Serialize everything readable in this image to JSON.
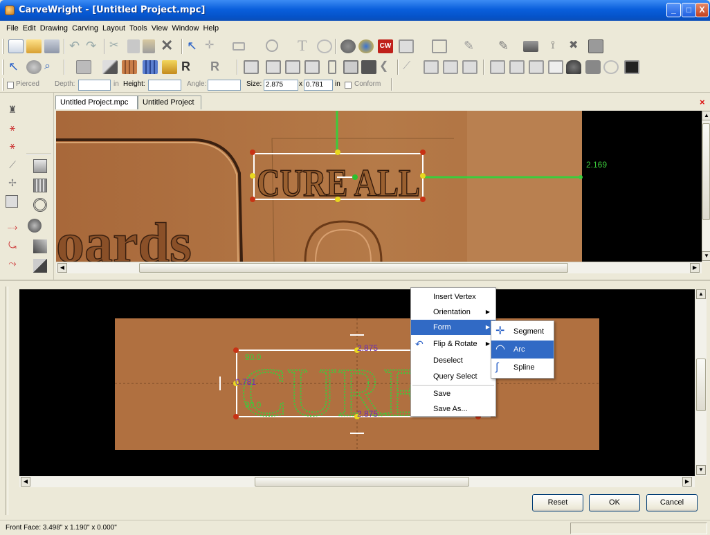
{
  "window": {
    "title": "CarveWright - [Untitled Project.mpc]",
    "minimize": "_",
    "maximize": "□",
    "close": "X"
  },
  "menu": [
    "File",
    "Edit",
    "Drawing",
    "Carving",
    "Layout",
    "Tools",
    "View",
    "Window",
    "Help"
  ],
  "props": {
    "pierced": "Pierced",
    "depth_label": "Depth:",
    "depth_value": "",
    "depth_unit": "in",
    "height_label": "Height:",
    "height_value": "",
    "angle_label": "Angle:",
    "angle_value": "",
    "size_label": "Size:",
    "size_w": "2.875",
    "size_x": "x",
    "size_h": "0.781",
    "size_unit": "in",
    "conform": "Conform"
  },
  "tabs": [
    "Untitled Project.mpc",
    "Untitled Project"
  ],
  "tab_close": "×",
  "view3d": {
    "text": "CURE ALL",
    "text_bottom": "oards",
    "measure": "2.169"
  },
  "editor": {
    "dim_top": "2.875",
    "dim_bottom": "2.875",
    "dim_left": "0.781",
    "angle_top": "90.0",
    "angle_bottom": "90.0",
    "text": "CURE A"
  },
  "context_menu": {
    "items": [
      "Insert Vertex",
      "Orientation",
      "Form",
      "Flip & Rotate",
      "Deselect",
      "Query Select",
      "Save",
      "Save As..."
    ],
    "submenu": [
      "Segment",
      "Arc",
      "Spline"
    ],
    "selected": "Form",
    "submenu_selected": "Arc"
  },
  "buttons": {
    "reset": "Reset",
    "ok": "OK",
    "cancel": "Cancel"
  },
  "status": {
    "text": "Front Face: 3.498\" x 1.190\" x 0.000\""
  },
  "colors": {
    "wood": "#b07040",
    "guide_green": "#3ccc3c",
    "dim_purple": "#6b2fb5",
    "selection_blue": "#316ac5"
  }
}
